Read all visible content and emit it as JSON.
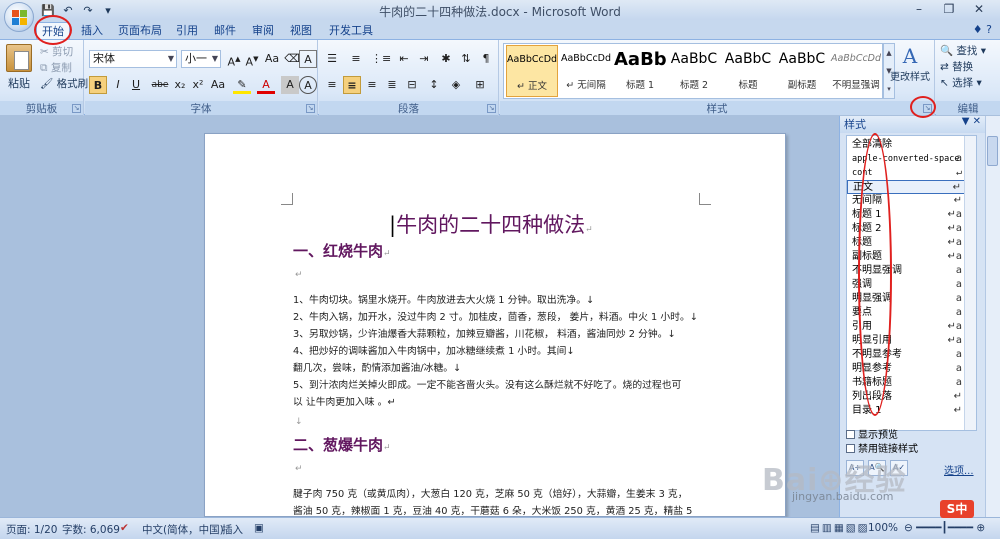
{
  "window": {
    "title": "牛肉的二十四种做法.docx - Microsoft Word",
    "min": "–",
    "max": "❐",
    "close": "✕"
  },
  "qat": {
    "save": "💾",
    "undo": "↶",
    "redo": "↷",
    "more": "▾"
  },
  "tabs": [
    "开始",
    "插入",
    "页面布局",
    "引用",
    "邮件",
    "审阅",
    "视图",
    "开发工具"
  ],
  "help": "♦ ?",
  "clipboard": {
    "paste": "粘贴",
    "cut": "剪切",
    "copy": "复制",
    "painter": "格式刷",
    "label": "剪贴板"
  },
  "font": {
    "name": "宋体",
    "size": "小一",
    "label": "字体",
    "buttons": [
      "B",
      "I",
      "U",
      "abe",
      "x₂",
      "x²",
      "Aa",
      "A",
      "A",
      "A",
      "A"
    ]
  },
  "paragraph": {
    "label": "段落"
  },
  "styles": {
    "label": "样式",
    "items": [
      {
        "sample": "AaBbCcDd",
        "name": "↵ 正文"
      },
      {
        "sample": "AaBbCcDd",
        "name": "↵ 无间隔"
      },
      {
        "sample": "AaBb",
        "name": "标题 1"
      },
      {
        "sample": "AaBbC",
        "name": "标题 2"
      },
      {
        "sample": "AaBbC",
        "name": "标题"
      },
      {
        "sample": "AaBbC",
        "name": "副标题"
      },
      {
        "sample": "AaBbCcDd",
        "name": "不明显强调"
      }
    ],
    "change": "更改样式"
  },
  "editing": {
    "find": "查找",
    "replace": "替换",
    "select": "选择",
    "label": "编辑"
  },
  "document": {
    "title": "牛肉的二十四种做法",
    "h1": "一、红烧牛肉",
    "lines": [
      "1、牛肉切块。锅里水烧开。牛肉放进去大火烧 1 分钟。取出洗净。↓",
      "2、牛肉入锅，加开水，没过牛肉 2 寸。加桂皮，茴香，葱段， 姜片，料酒。中火 1 小时。↓",
      "3、另取炒锅，少许油爆香大蒜颗粒，加辣豆瓣酱，川花椒， 料酒，酱油同炒 2 分钟。↓",
      "4、把炒好的调味酱加入牛肉锅中，加冰糖继续煮 1 小时。其间↓",
      "翻几次，尝味，酌情添加酱油/冰糖。↓",
      "5、到汁浓肉烂关掉火即成。一定不能吝啬火头。没有这么酥烂就不好吃了。烧的过程也可",
      "以 让牛肉更加入味 。↵"
    ],
    "h2": "二、葱爆牛肉",
    "lines2": [
      "腱子肉 750 克（或黄瓜肉），大葱白 120 克，芝麻 50 克（焙好），大蒜瓣，生姜末 3 克，",
      "酱油 50 克，辣椒面 1 克，豆油 40 克，干蘑菇 6 朵，大米饭 250 克，黄酒 25 克，精盐 5"
    ]
  },
  "pane": {
    "title": "样式",
    "items": [
      {
        "name": "全部清除",
        "mark": ""
      },
      {
        "name": "apple-converted-space",
        "mark": "a"
      },
      {
        "name": "cont",
        "mark": "↵"
      },
      {
        "name": "正文",
        "mark": "↵"
      },
      {
        "name": "无间隔",
        "mark": "↵"
      },
      {
        "name": "标题 1",
        "mark": "↵a"
      },
      {
        "name": "标题 2",
        "mark": "↵a"
      },
      {
        "name": "标题",
        "mark": "↵a"
      },
      {
        "name": "副标题",
        "mark": "↵a"
      },
      {
        "name": "不明显强调",
        "mark": "a"
      },
      {
        "name": "强调",
        "mark": "a"
      },
      {
        "name": "明显强调",
        "mark": "a"
      },
      {
        "name": "要点",
        "mark": "a"
      },
      {
        "name": "引用",
        "mark": "↵a"
      },
      {
        "name": "明显引用",
        "mark": "↵a"
      },
      {
        "name": "不明显参考",
        "mark": "a"
      },
      {
        "name": "明显参考",
        "mark": "a"
      },
      {
        "name": "书籍标题",
        "mark": "a"
      },
      {
        "name": "列出段落",
        "mark": "↵"
      },
      {
        "name": "目录 1",
        "mark": "↵"
      }
    ],
    "preview": "显示预览",
    "linked": "禁用链接样式",
    "options": "选项..."
  },
  "status": {
    "page": "页面: 1/20",
    "words": "字数: 6,069",
    "lang": "中文(简体，中国)",
    "insert": "插入",
    "zoom": "100%"
  },
  "watermark": {
    "brand": "Bai⊕经验",
    "url": "jingyan.baidu.com"
  },
  "ime": "S中"
}
